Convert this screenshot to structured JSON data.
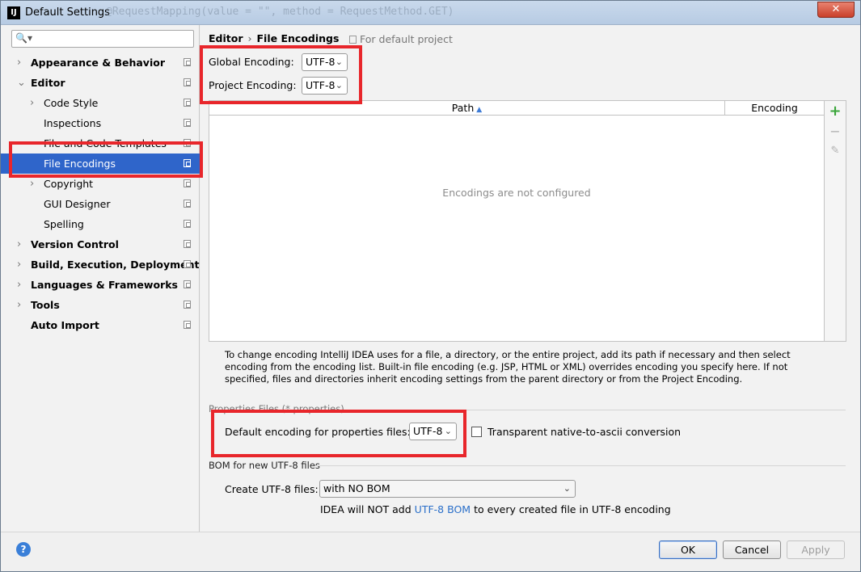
{
  "window": {
    "title": "Default Settings",
    "app_icon_text": "IJ",
    "ghost_code": "@RequestMapping(value = \"\", method = RequestMethod.GET)",
    "close_symbol": "✕"
  },
  "sidebar": {
    "search_placeholder": "",
    "items": [
      {
        "label": "Appearance & Behavior",
        "level": 0,
        "bold": true,
        "arrow": "›"
      },
      {
        "label": "Editor",
        "level": 0,
        "bold": true,
        "arrow": "⌄"
      },
      {
        "label": "Code Style",
        "level": 1,
        "bold": false,
        "arrow": "›"
      },
      {
        "label": "Inspections",
        "level": 1,
        "bold": false,
        "arrow": ""
      },
      {
        "label": "File and Code Templates",
        "level": 1,
        "bold": false,
        "arrow": ""
      },
      {
        "label": "File Encodings",
        "level": 1,
        "bold": false,
        "arrow": "",
        "selected": true
      },
      {
        "label": "Copyright",
        "level": 1,
        "bold": false,
        "arrow": "›"
      },
      {
        "label": "GUI Designer",
        "level": 1,
        "bold": false,
        "arrow": ""
      },
      {
        "label": "Spelling",
        "level": 1,
        "bold": false,
        "arrow": ""
      },
      {
        "label": "Version Control",
        "level": 0,
        "bold": true,
        "arrow": "›"
      },
      {
        "label": "Build, Execution, Deployment",
        "level": 0,
        "bold": true,
        "arrow": "›"
      },
      {
        "label": "Languages & Frameworks",
        "level": 0,
        "bold": true,
        "arrow": "›"
      },
      {
        "label": "Tools",
        "level": 0,
        "bold": true,
        "arrow": "›"
      },
      {
        "label": "Auto Import",
        "level": 0,
        "bold": true,
        "arrow": ""
      }
    ]
  },
  "main": {
    "breadcrumb": {
      "parent": "Editor",
      "sep": "›",
      "current": "File Encodings",
      "scope": "For default project"
    },
    "global_encoding": {
      "label": "Global Encoding:",
      "value": "UTF-8"
    },
    "project_encoding": {
      "label": "Project Encoding:",
      "value": "UTF-8"
    },
    "table": {
      "columns": [
        "Path",
        "Encoding"
      ],
      "sort_indicator": "▲",
      "empty_text": "Encodings are not configured"
    },
    "table_tools": {
      "add": "+",
      "remove": "−",
      "edit": "✎"
    },
    "help_text": "To change encoding IntelliJ IDEA uses for a file, a directory, or the entire project, add its path if necessary and then select encoding from the encoding list. Built-in file encoding (e.g. JSP, HTML or XML) overrides encoding you specify here. If not specified, files and directories inherit encoding settings from the parent directory or from the Project Encoding.",
    "properties": {
      "group_title": "Properties Files (*.properties)",
      "default_label": "Default encoding for properties files:",
      "default_value": "UTF-8",
      "transparent_label": "Transparent native-to-ascii conversion",
      "transparent_checked": false
    },
    "bom": {
      "group_title": "BOM for new UTF-8 files",
      "create_label": "Create UTF-8 files:",
      "create_value": "with NO BOM",
      "note_prefix": "IDEA will NOT add",
      "note_link": "UTF-8 BOM",
      "note_suffix": "to every created file in UTF-8 encoding"
    }
  },
  "footer": {
    "help": "?",
    "ok": "OK",
    "cancel": "Cancel",
    "apply": "Apply",
    "apply_enabled": false
  },
  "annotations": {
    "highlight_color": "#e8262b"
  }
}
